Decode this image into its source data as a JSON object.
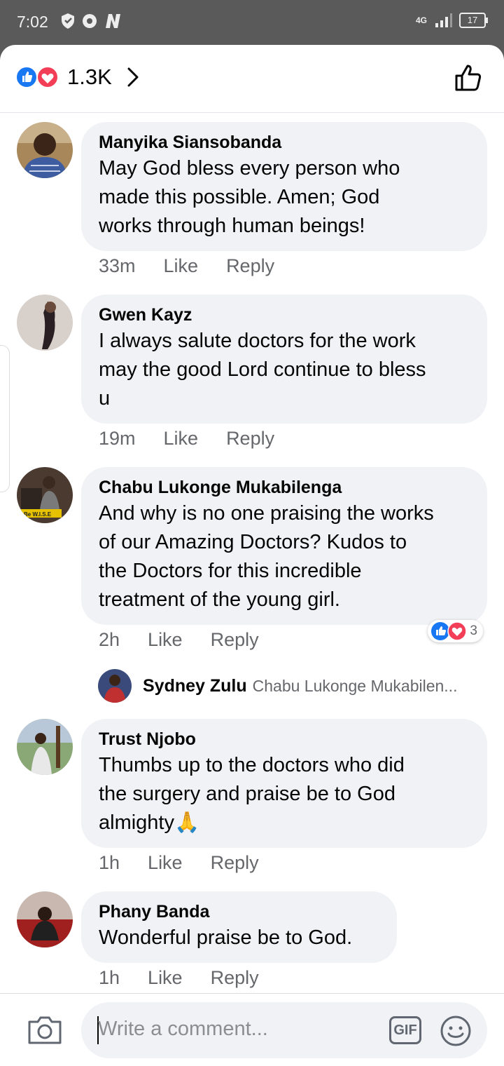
{
  "status": {
    "time": "7:02",
    "network": "4G",
    "battery": "17"
  },
  "header": {
    "reaction_count": "1.3K"
  },
  "comments": [
    {
      "name": "Manyika Siansobanda",
      "text": [
        "May God bless every person who",
        "made this possible. Amen; God",
        "works through human beings!"
      ],
      "time": "33m",
      "like": "Like",
      "reply": "Reply"
    },
    {
      "name": "Gwen Kayz",
      "text": [
        "I always salute doctors for the work",
        "may the good Lord continue to bless",
        "u"
      ],
      "time": "19m",
      "like": "Like",
      "reply": "Reply"
    },
    {
      "name": "Chabu Lukonge Mukabilenga",
      "text": [
        "And why is no one praising the works",
        "of our Amazing Doctors? Kudos to",
        "the Doctors for this incredible",
        "treatment of the young girl."
      ],
      "time": "2h",
      "like": "Like",
      "reply": "Reply",
      "reactions": "3"
    },
    {
      "name": "Trust Njobo",
      "text": [
        "Thumbs up to the doctors who did",
        "the surgery and praise be to God",
        "almighty🙏"
      ],
      "time": "1h",
      "like": "Like",
      "reply": "Reply"
    },
    {
      "name": "Phany Banda",
      "text": [
        "Wonderful praise be to God."
      ],
      "time": "1h",
      "like": "Like",
      "reply": "Reply"
    }
  ],
  "reply_preview": {
    "name": "Sydney Zulu",
    "text": "Chabu Lukonge Mukabilen..."
  },
  "composer": {
    "placeholder": "Write a comment...",
    "gif_label": "GIF"
  },
  "colors": {
    "like_blue": "#1877f2",
    "love_red": "#f33e58",
    "bubble_bg": "#f0f2f5",
    "muted_text": "#65676b"
  }
}
